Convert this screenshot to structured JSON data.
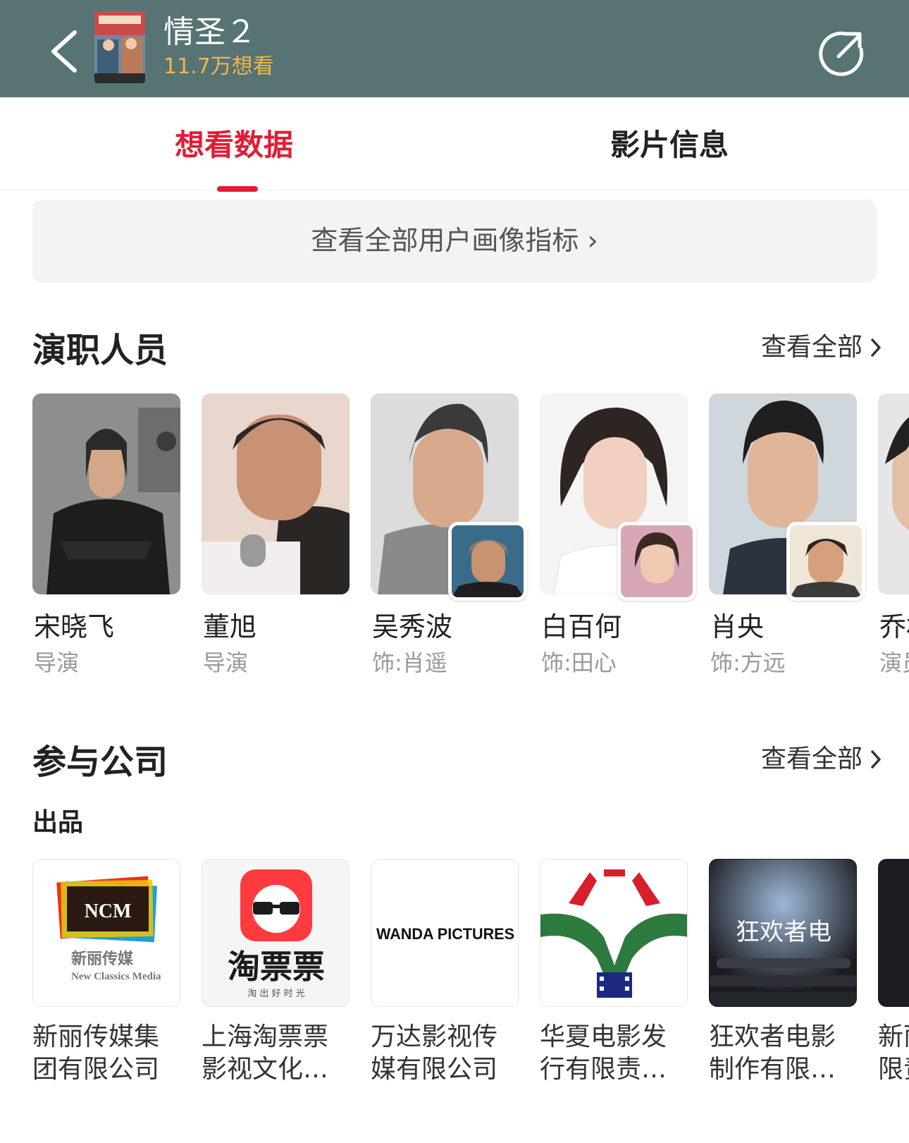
{
  "header": {
    "title": "情圣２",
    "want_count": "11.7万想看",
    "colors": {
      "bar": "#577373",
      "want": "#f2b64a"
    }
  },
  "tabs": [
    {
      "label": "想看数据",
      "active": true
    },
    {
      "label": "影片信息",
      "active": false
    }
  ],
  "profile_button": {
    "label": "查看全部用户画像指标 ›"
  },
  "cast": {
    "title": "演职人员",
    "view_all": "查看全部",
    "items": [
      {
        "name": "宋晓飞",
        "role": "导演"
      },
      {
        "name": "董旭",
        "role": "导演"
      },
      {
        "name": "吴秀波",
        "role": "饰:肖遥"
      },
      {
        "name": "白百何",
        "role": "饰:田心"
      },
      {
        "name": "肖央",
        "role": "饰:方远"
      },
      {
        "name": "乔杉",
        "role": "演员"
      }
    ]
  },
  "companies": {
    "title": "参与公司",
    "view_all": "查看全部",
    "subtitle": "出品",
    "items": [
      {
        "name_line1": "新丽传媒集",
        "name_line2": "团有限公司",
        "logo_text": "NCM",
        "logo_sub": "新丽传媒",
        "logo_en": "New Classics Media"
      },
      {
        "name_line1": "上海淘票票",
        "name_line2": "影视文化…",
        "logo_text": "淘票票",
        "logo_sub": "淘 出 好 时 光"
      },
      {
        "name_line1": "万达影视传",
        "name_line2": "媒有限公司",
        "logo_text": "WANDA PICTURES"
      },
      {
        "name_line1": "华夏电影发",
        "name_line2": "行有限责…"
      },
      {
        "name_line1": "狂欢者电影",
        "name_line2": "制作有限…",
        "logo_text": "狂欢者电"
      },
      {
        "name_line1": "新丽",
        "name_line2": "限责"
      }
    ]
  },
  "accent_color": "#e21c36"
}
